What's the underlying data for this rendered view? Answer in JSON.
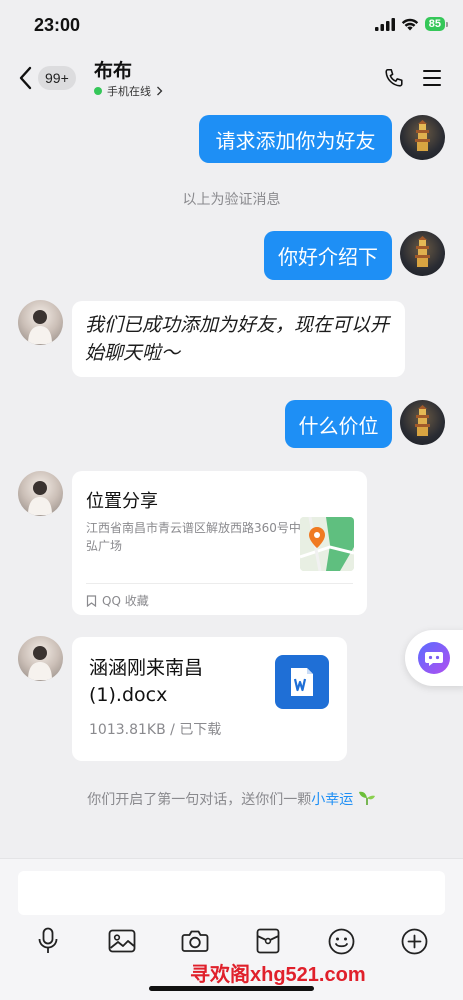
{
  "status_bar": {
    "time": "23:00",
    "battery": "85"
  },
  "nav": {
    "unread_count": "99+",
    "contact_name": "布布",
    "status_text": "手机在线"
  },
  "messages": {
    "sent_1": "请求添加你为好友",
    "system_verify": "以上为验证消息",
    "sent_2": "你好介绍下",
    "received_1": "我们已成功添加为好友，现在可以开始聊天啦～",
    "sent_3": "什么价位",
    "location": {
      "title": "位置分享",
      "address": "江西省南昌市青云谱区解放西路360号中弘广场",
      "footer": "QQ 收藏"
    },
    "file": {
      "name": "涵涵刚来南昌(1).docx",
      "size": "1013.81KB",
      "status": "已下载"
    },
    "system_first_chat": "你们开启了第一句对话，送你们一颗",
    "system_gift": "小幸运"
  },
  "watermark": "寻欢阁xhg521.com",
  "colors": {
    "accent": "#1e8ff5",
    "online": "#35c759",
    "background": "#efeff1"
  },
  "icons": [
    "back-chevron-icon",
    "phone-icon",
    "menu-icon",
    "voice-icon",
    "image-icon",
    "camera-icon",
    "red-packet-icon",
    "emoji-icon",
    "plus-icon",
    "word-doc-icon",
    "map-pin-icon",
    "sprout-icon"
  ]
}
